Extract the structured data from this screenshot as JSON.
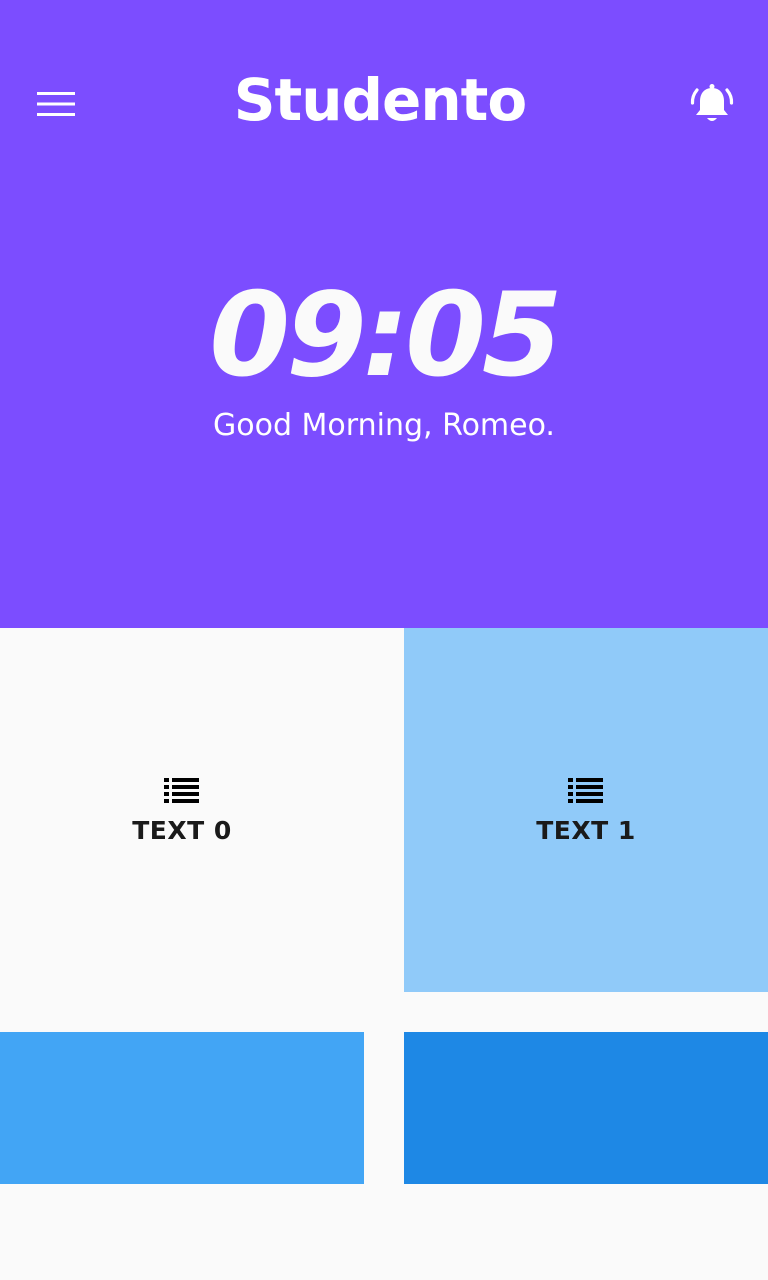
{
  "header": {
    "title": "Studento",
    "menu_icon": "menu-icon",
    "notification_icon": "bell-ringing-icon",
    "background": "#7C4DFF"
  },
  "hero": {
    "time": "09:05",
    "greeting": "Good Morning, Romeo."
  },
  "tiles": [
    {
      "label": "TEXT 0",
      "icon": "list-icon",
      "color": "#FAFAFA"
    },
    {
      "label": "TEXT 1",
      "icon": "list-icon",
      "color": "#90CAF9"
    },
    {
      "label": "",
      "color": "#42A5F5"
    },
    {
      "label": "",
      "color": "#1E88E5"
    }
  ]
}
